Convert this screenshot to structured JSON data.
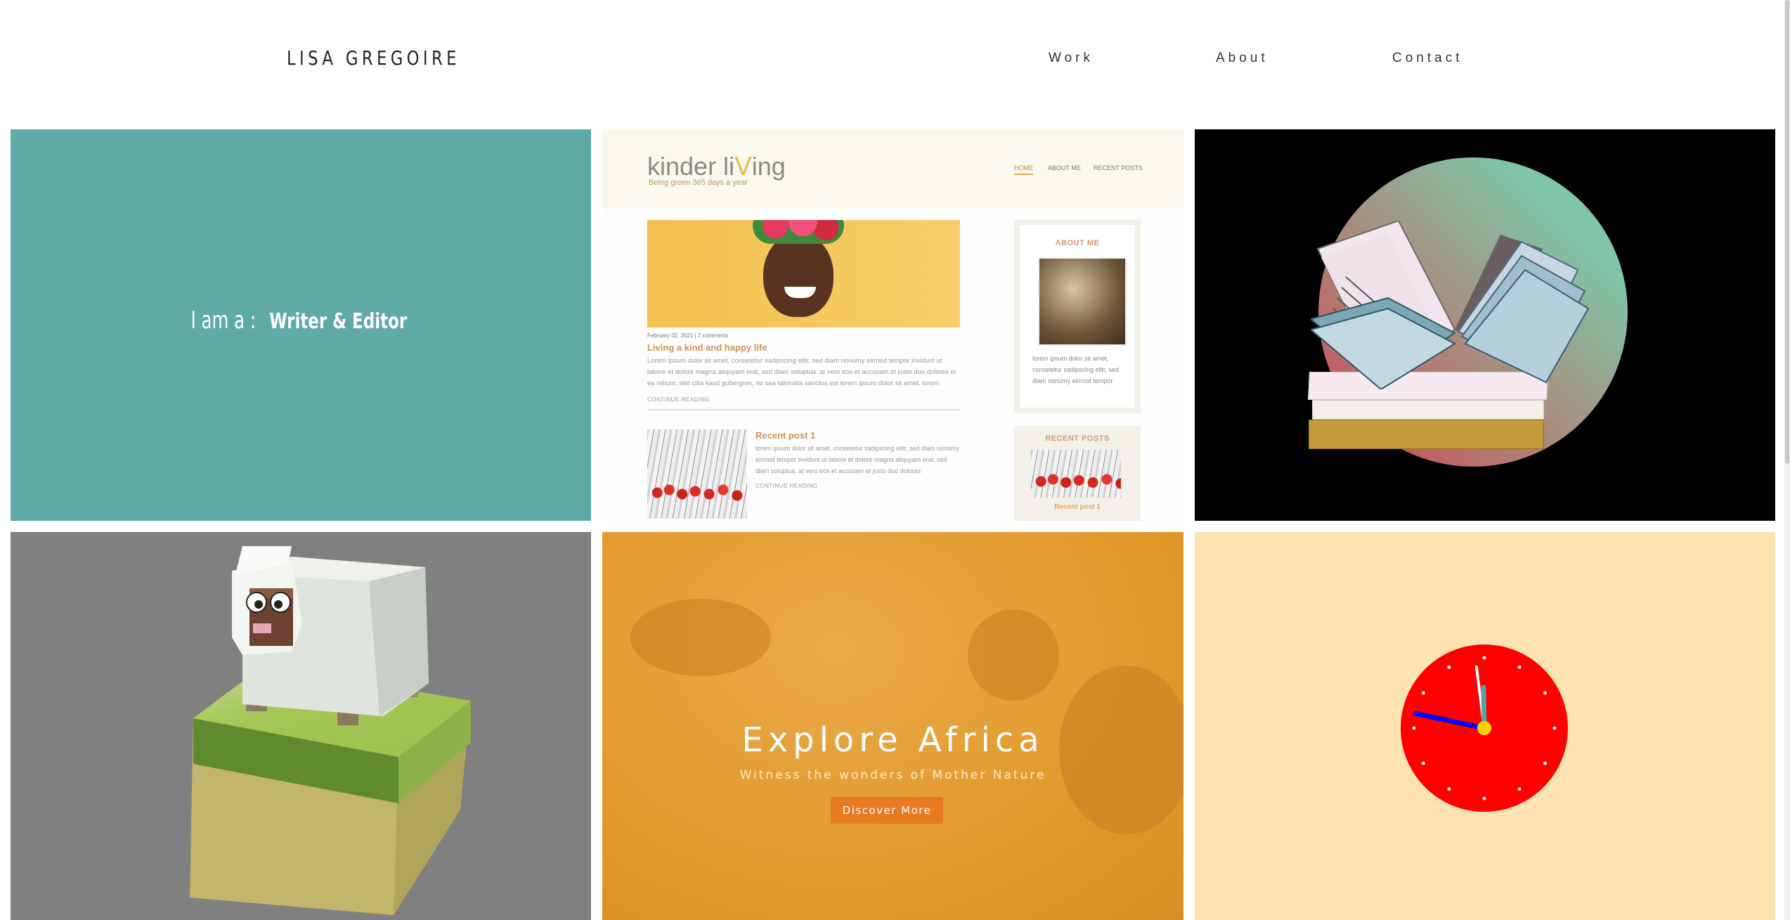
{
  "header": {
    "brand": "LISA GREGOIRE",
    "nav": [
      {
        "label": "Work"
      },
      {
        "label": "About"
      },
      {
        "label": "Contact"
      }
    ]
  },
  "tiles": {
    "writer": {
      "prefix": "I am a :",
      "role": "Writer & Editor",
      "bg_color": "#5fa9a6"
    },
    "kinder_living": {
      "logo_part1": "kinder li",
      "logo_leaf": "ᐯ",
      "logo_part2": "ing",
      "tagline": "Being green 365 days a year",
      "nav": [
        "HOME",
        "ABOUT ME",
        "RECENT POSTS"
      ],
      "post": {
        "meta": "February 02, 2021  |  7 comments",
        "title": "Living a kind and happy life",
        "text": "Lorem ipsum dolor sit amet, consetetur sadipscing elitr, sed diam nonumy eirmod tempor invidunt ut labore et dolore magna aliquyam erat, sed diam voluptua. at vero eos et accusam et justo duo dolores et ea rebum. stet clita kasd gubergren, no sea takimata sanctus est lorem ipsum dolor sit amet. lorem",
        "continue": "CONTINUE READING"
      },
      "recent": {
        "title": "Recent post 1",
        "text": "lorem ipsum dolor sit amet, consetetur sadipscing elitr, sed diam nonumy eirmod tempor invidunt ut labore et dolore magna aliquyam erat, sed diam voluptua. at vero eos et accusam et justo duo dolores",
        "continue": "CONTINUE READING"
      },
      "sidebar": {
        "about_heading": "ABOUT ME",
        "about_text": "lorem ipsum dolor sit amet, consetetur sadipscing elitr, sed diam nonumy eirmod tempor",
        "recent_heading": "RECENT POSTS",
        "recent_caption": "Recent post 1"
      }
    },
    "explore_africa": {
      "title": "Explore Africa",
      "subtitle": "Witness the wonders of Mother Nature",
      "button": "Discover More"
    },
    "clock": {
      "hours": 11,
      "minutes": 58,
      "seconds": 47,
      "face_color": "#ff0000",
      "bg_color": "#fee3b1"
    }
  }
}
